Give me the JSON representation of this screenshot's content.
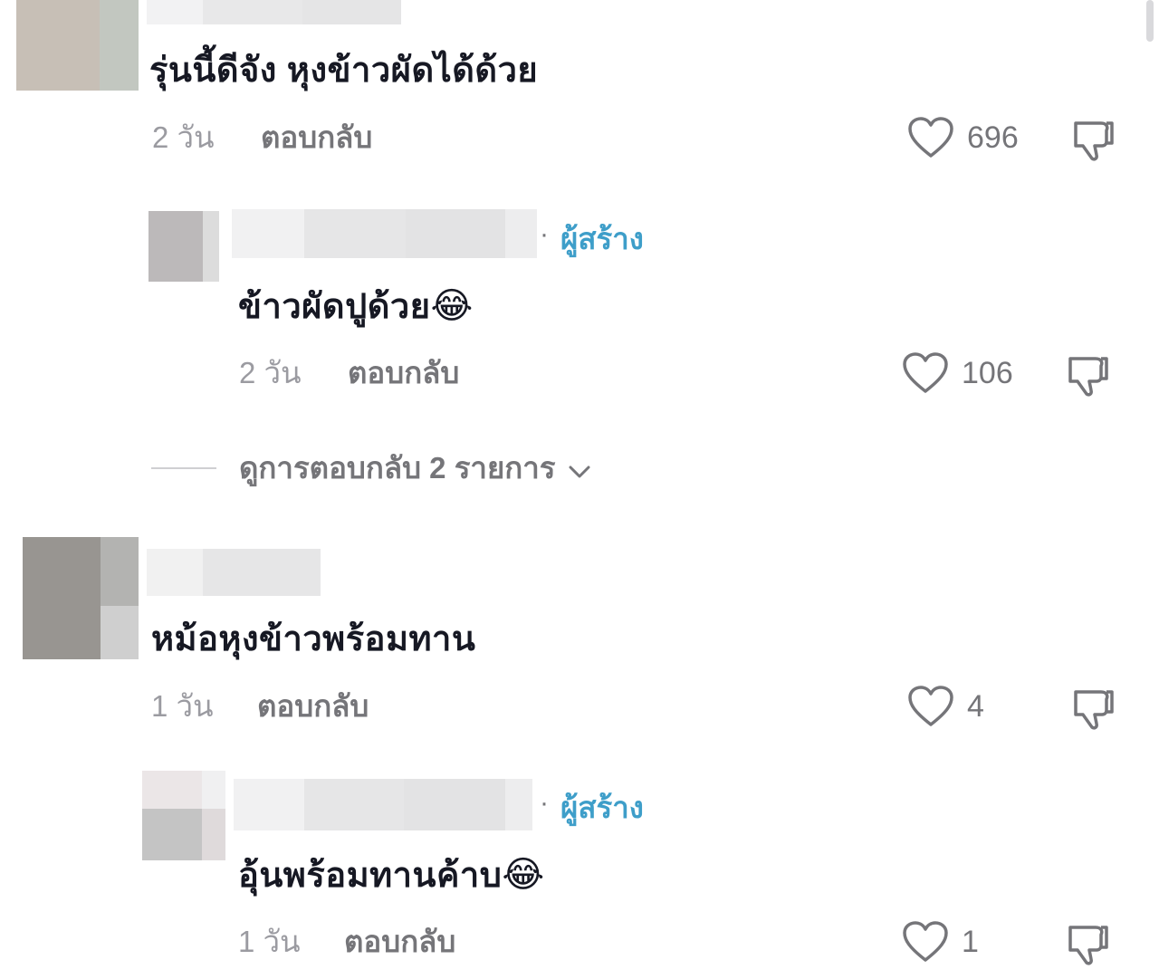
{
  "comments": [
    {
      "text": "รุ่นนี้ดีจัง หุงข้าวผัดได้ด้วย",
      "date": "2 วัน",
      "reply_label": "ตอบกลับ",
      "likes": "696",
      "replies": [
        {
          "creator_label": "ผู้สร้าง",
          "text": "ข้าวผัดปูด้วย",
          "emoji": "😂",
          "date": "2 วัน",
          "reply_label": "ตอบกลับ",
          "likes": "106"
        }
      ],
      "view_more_replies": "ดูการตอบกลับ 2 รายการ"
    },
    {
      "text": "หม้อหุงข้าวพร้อมทาน",
      "date": "1 วัน",
      "reply_label": "ตอบกลับ",
      "likes": "4",
      "replies": [
        {
          "creator_label": "ผู้สร้าง",
          "text": "อุ้นพร้อมทานค้าบ",
          "emoji": "😂",
          "date": "1 วัน",
          "reply_label": "ตอบกลับ",
          "likes": "1"
        }
      ]
    }
  ],
  "icons": {
    "like": "heart-outline-icon",
    "dislike": "thumbs-down-icon",
    "expand": "chevron-down-icon"
  },
  "colors": {
    "creator_accent": "#3e9ec9",
    "secondary_text": "#757579",
    "muted_text": "#9b9ba1"
  }
}
